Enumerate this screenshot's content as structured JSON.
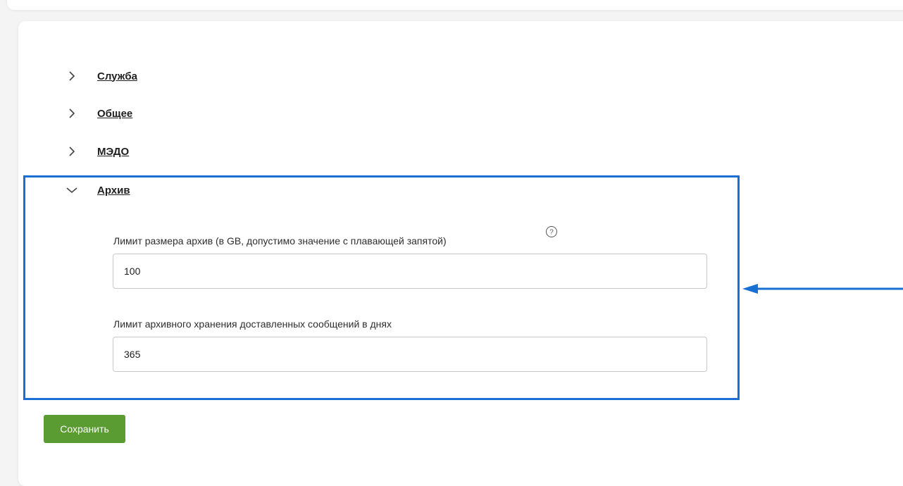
{
  "sections": [
    {
      "label": "Служба",
      "expanded": false,
      "icon": "chevron-right-icon"
    },
    {
      "label": "Общее",
      "expanded": false,
      "icon": "chevron-right-icon"
    },
    {
      "label": "МЭДО",
      "expanded": false,
      "icon": "chevron-right-icon"
    },
    {
      "label": "Архив",
      "expanded": true,
      "icon": "chevron-down-icon"
    }
  ],
  "archive": {
    "size_limit_label": "Лимит размера архив (в GB, допустимо значение с плавающей запятой)",
    "size_limit_value": "100",
    "help_icon": "question-circle-icon",
    "retention_label": "Лимит архивного хранения доставленных сообщений в днях",
    "retention_value": "365"
  },
  "actions": {
    "save_label": "Сохранить"
  },
  "annotation": {
    "highlight_color": "#1a6fd3",
    "arrow_icon": "arrow-left-icon"
  },
  "colors": {
    "save_button": "#5a9b32"
  }
}
